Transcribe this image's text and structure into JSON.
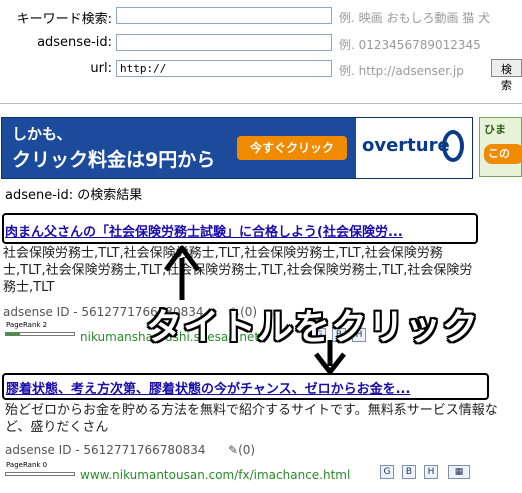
{
  "form": {
    "keyword_label": "キーワード検索:",
    "keyword_value": "",
    "keyword_hint": "例. 映画 おもしろ動画 猫 犬",
    "adsense_label": "adsense-id:",
    "adsense_value": "",
    "adsense_hint": "例. 0123456789012345",
    "url_label": "url:",
    "url_value": "http://",
    "url_hint": "例. http://adsenser.jp",
    "search_button": "検索"
  },
  "banner": {
    "line1": "しかも、",
    "line2": "クリック料金は9円から",
    "cta": "今すぐクリック",
    "brand": "overture",
    "side_top": "ひま",
    "side_bottom": "この"
  },
  "results_heading": "adsene-id: の検索結果",
  "results": [
    {
      "title": "肉まん父さんの「社会保険労務士試験」に合格しよう(社会保険労...",
      "description": "社会保険労務士,TLT,社会保険労務士,TLT,社会保険労務士,TLT,社会保険労務士,TLT,社会保険労務士,TLT,社会保険労務士,TLT,社会保険労務士,TLT,社会保険労務士,TLT",
      "adsense": "adsense ID - 5612771766780834",
      "comments": "(0)",
      "pagerank": "PageRank 2",
      "url": "nikumansharoushi.seesaa.net/"
    },
    {
      "title": "膠着状態、考え方次第、膠着状態の今がチャンス、ゼロからお金を...",
      "description": "殆どゼロからお金を貯める方法を無料で紹介するサイトです。無料系サービス情報など、盛りだくさん",
      "adsense": "adsense ID - 5612771766780834",
      "comments": "(0)",
      "pagerank": "PageRank 0",
      "url": "www.nikumantousan.com/fx/imachance.html"
    }
  ],
  "annotation": {
    "text": "タイトルをクリック"
  },
  "colors": {
    "banner_bg": "#1d4b9c",
    "cta_bg": "#f08a00",
    "link": "#1a0dab",
    "url": "#2a8a2a"
  }
}
